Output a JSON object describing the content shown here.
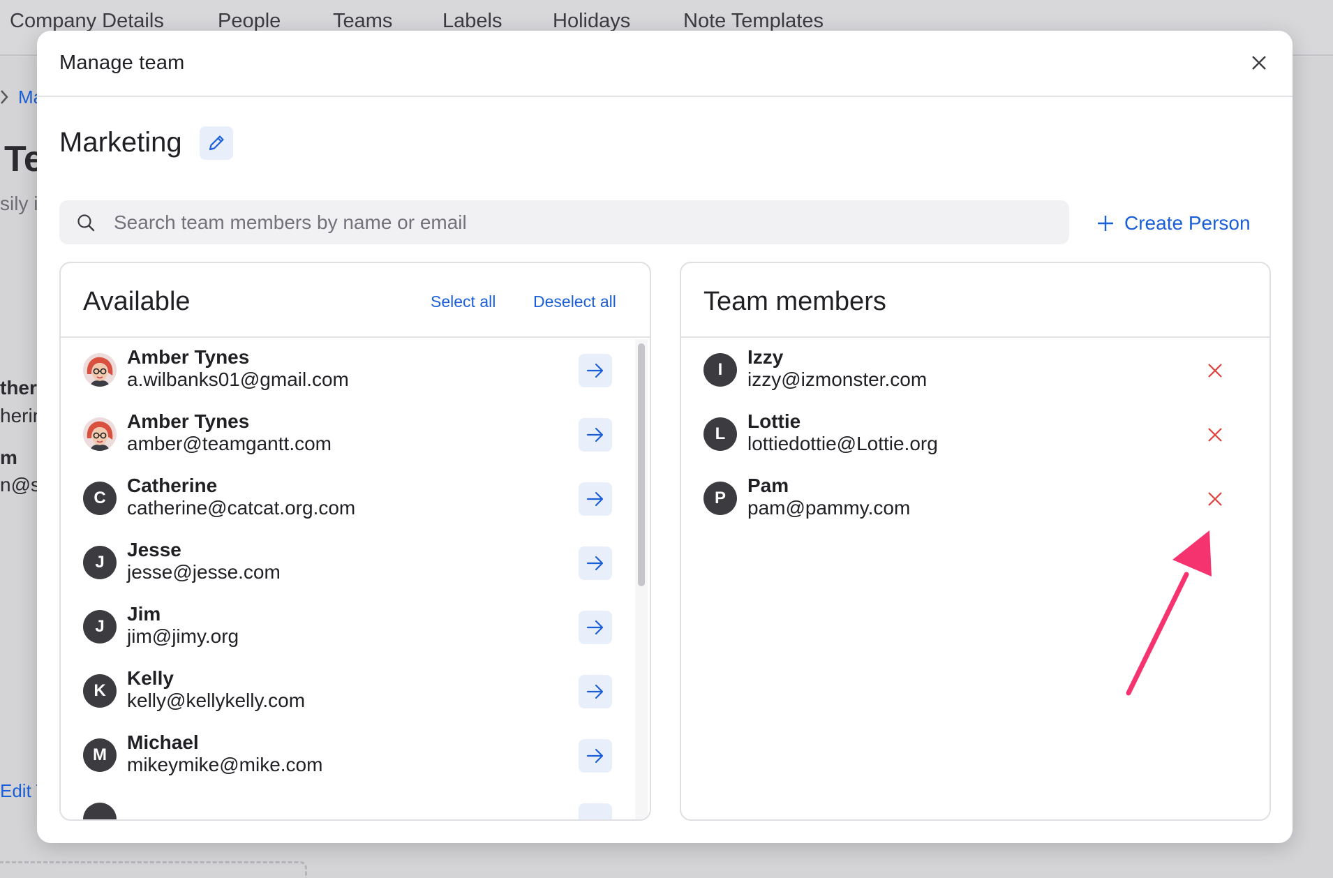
{
  "background": {
    "tabs": [
      "Company Details",
      "People",
      "Teams",
      "Labels",
      "Holidays",
      "Note Templates"
    ],
    "breadcrumb_fragment": "Ma",
    "title_fragment": "Te",
    "subtitle_fragment": "sily i",
    "row1_name_fragment": "ther",
    "row1_sub_fragment": "herin",
    "row2_name_fragment": "m",
    "row2_sub_fragment": "n@sa",
    "edit_link_fragment": "Edit T"
  },
  "modal": {
    "title": "Manage team",
    "close_icon": "close-icon",
    "team_name": "Marketing",
    "edit_icon": "pencil-icon"
  },
  "search": {
    "placeholder": "Search team members by name or email",
    "value": ""
  },
  "create_person": {
    "label": "Create Person",
    "icon": "plus-icon"
  },
  "available": {
    "title": "Available",
    "select_all": "Select all",
    "deselect_all": "Deselect all",
    "people": [
      {
        "name": "Amber Tynes",
        "email": "a.wilbanks01@gmail.com",
        "initial": "",
        "photo": true
      },
      {
        "name": "Amber Tynes",
        "email": "amber@teamgantt.com",
        "initial": "",
        "photo": true
      },
      {
        "name": "Catherine",
        "email": "catherine@catcat.org.com",
        "initial": "C",
        "photo": false
      },
      {
        "name": "Jesse",
        "email": "jesse@jesse.com",
        "initial": "J",
        "photo": false
      },
      {
        "name": "Jim",
        "email": "jim@jimy.org",
        "initial": "J",
        "photo": false
      },
      {
        "name": "Kelly",
        "email": "kelly@kellykelly.com",
        "initial": "K",
        "photo": false
      },
      {
        "name": "Michael",
        "email": "mikeymike@mike.com",
        "initial": "M",
        "photo": false
      }
    ]
  },
  "members": {
    "title": "Team members",
    "people": [
      {
        "name": "Izzy",
        "email": "izzy@izmonster.com",
        "initial": "I"
      },
      {
        "name": "Lottie",
        "email": "lottiedottie@Lottie.org",
        "initial": "L"
      },
      {
        "name": "Pam",
        "email": "pam@pammy.com",
        "initial": "P"
      }
    ]
  },
  "colors": {
    "accent": "#1a5fd8",
    "remove": "#e0403a",
    "annotation": "#f5336f"
  }
}
